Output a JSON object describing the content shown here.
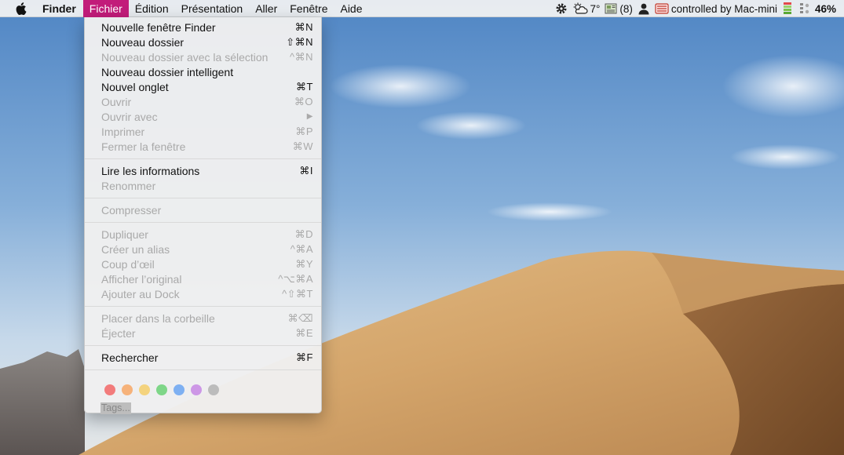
{
  "menubar": {
    "app_name": "Finder",
    "menus": [
      "Fichier",
      "Édition",
      "Présentation",
      "Aller",
      "Fenêtre",
      "Aide"
    ],
    "active_menu": "Fichier",
    "active_color": "#c21c7a",
    "status": {
      "weather_temp": "7°",
      "notification_count": "(8)",
      "remote_label": "controlled by Mac-mini",
      "battery_percent": "46%"
    }
  },
  "file_menu": {
    "items": [
      {
        "label": "Nouvelle fenêtre Finder",
        "shortcut": "⌘N",
        "enabled": true
      },
      {
        "label": "Nouveau dossier",
        "shortcut": "⇧⌘N",
        "enabled": true
      },
      {
        "label": "Nouveau dossier avec la sélection",
        "shortcut": "^⌘N",
        "enabled": false
      },
      {
        "label": "Nouveau dossier intelligent",
        "shortcut": "",
        "enabled": true
      },
      {
        "label": "Nouvel onglet",
        "shortcut": "⌘T",
        "enabled": true
      },
      {
        "label": "Ouvrir",
        "shortcut": "⌘O",
        "enabled": false
      },
      {
        "label": "Ouvrir avec",
        "shortcut": "▶",
        "enabled": false
      },
      {
        "label": "Imprimer",
        "shortcut": "⌘P",
        "enabled": false
      },
      {
        "label": "Fermer la fenêtre",
        "shortcut": "⌘W",
        "enabled": false
      },
      {
        "label": "Lire les informations",
        "shortcut": "⌘I",
        "enabled": true
      },
      {
        "label": "Renommer",
        "shortcut": "",
        "enabled": false
      },
      {
        "label": "Compresser",
        "shortcut": "",
        "enabled": false
      },
      {
        "label": "Dupliquer",
        "shortcut": "⌘D",
        "enabled": false
      },
      {
        "label": "Créer un alias",
        "shortcut": "^⌘A",
        "enabled": false
      },
      {
        "label": "Coup d’œil",
        "shortcut": "⌘Y",
        "enabled": false
      },
      {
        "label": "Afficher l’original",
        "shortcut": "^⌥⌘A",
        "enabled": false
      },
      {
        "label": "Ajouter au Dock",
        "shortcut": "^⇧⌘T",
        "enabled": false
      },
      {
        "label": "Placer dans la corbeille",
        "shortcut": "⌘⌫",
        "enabled": false
      },
      {
        "label": "Éjecter",
        "shortcut": "⌘E",
        "enabled": false
      },
      {
        "label": "Rechercher",
        "shortcut": "⌘F",
        "enabled": true
      }
    ],
    "tag_colors": [
      {
        "name": "red-tag",
        "color": "#f27b7b"
      },
      {
        "name": "orange-tag",
        "color": "#f6b27a"
      },
      {
        "name": "yellow-tag",
        "color": "#f4d37e"
      },
      {
        "name": "green-tag",
        "color": "#7ed688"
      },
      {
        "name": "blue-tag",
        "color": "#7eb0f2"
      },
      {
        "name": "purple-tag",
        "color": "#cd97e6"
      },
      {
        "name": "gray-tag",
        "color": "#bcbcbc"
      }
    ],
    "tags_label": "Tags..."
  }
}
